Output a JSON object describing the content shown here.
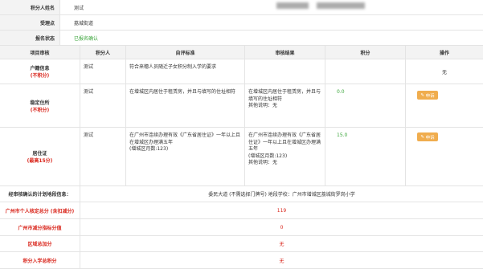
{
  "info": {
    "name_label": "积分人姓名",
    "name_value": "测试",
    "site_label": "受理点",
    "site_value": "荔城街道",
    "status_label": "报名状态",
    "status_value": "已报名确认"
  },
  "table": {
    "headers": [
      "项目审核",
      "积分人",
      "自评标准",
      "审核结果",
      "积分",
      "操作"
    ],
    "rows": [
      {
        "item": "户籍信息",
        "item_sub": "(不积分)",
        "person": "测试",
        "standard": "符合来穗人员随迁子女积分制入学的要求",
        "result": "",
        "score": "",
        "action": "无",
        "has_button": false
      },
      {
        "item": "稳定住所",
        "item_sub": "(不积分)",
        "person": "测试",
        "standard": "在增城区内居住于租赁房，并且与填写的住址相符",
        "result": "在增城区内居住于租赁房，并且与填写的住址相符\n其他说明：无",
        "score": "0.0",
        "action": "申诉",
        "has_button": true
      },
      {
        "item": "居住证",
        "item_sub": "(最高15分)",
        "person": "测试",
        "standard": "在广州市连续办理有效《广东省居住证》一年以上且在增城区办理满五年\n(增城区月数:123)",
        "result": "在广州市连续办理有效《广东省居住证》一年以上且在增城区办理满五年\n(增城区月数:123)\n其他说明：无",
        "score": "15.0",
        "action": "申诉",
        "has_button": true
      }
    ]
  },
  "summary": {
    "school_label": "经审核确认的计划地段信息：",
    "school_value": "委民大道 (不需选择门牌号) 地段学校：广州市增城区荔城街罗岗小学",
    "rows": [
      {
        "label": "广州市个人核定总分 (含扣减分)",
        "value": "119"
      },
      {
        "label": "广州市减分指标分值",
        "value": "0"
      },
      {
        "label": "区域总加分",
        "value": "无"
      },
      {
        "label": "积分入学总积分",
        "value": "无"
      }
    ]
  },
  "colors": {
    "accent": "#3aa53a",
    "warn": "#d9261c",
    "button": "#f0ad4e"
  }
}
